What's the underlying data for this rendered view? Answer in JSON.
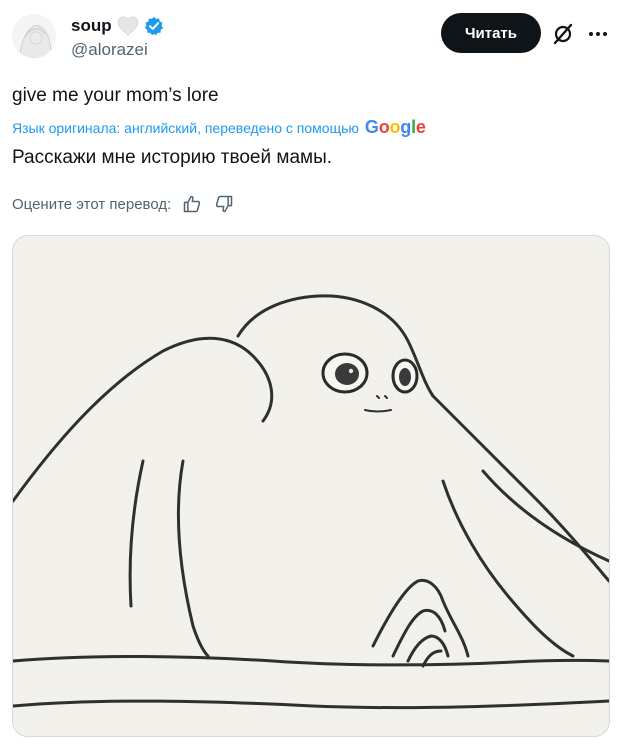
{
  "author": {
    "display_name": "soup",
    "handle": "@alorazei",
    "avatar_icon": "avatar-sketch",
    "badge_icons": [
      "white-heart-icon",
      "verified-badge-icon"
    ]
  },
  "header": {
    "follow_label": "Читать",
    "grok_icon": "grok-icon",
    "more_icon": "more-icon"
  },
  "tweet": {
    "text": "give me your mom’s lore",
    "translation_info": "Язык оригинала: английский, переведено с помощью",
    "translation_provider": "Google",
    "translated_text": "Расскажи мне историю твоей мамы.",
    "rate_label": "Оцените этот перевод:",
    "rate_icons": [
      "thumbs-up-icon",
      "thumbs-down-icon"
    ]
  },
  "media": {
    "image": "pencil-sketch-creature"
  },
  "colors": {
    "text": "#0f1419",
    "secondary": "#536471",
    "link": "#1d9bf0",
    "follow_bg": "#0f1419",
    "verified": "#1d9bf0",
    "border": "#cfd9de"
  }
}
